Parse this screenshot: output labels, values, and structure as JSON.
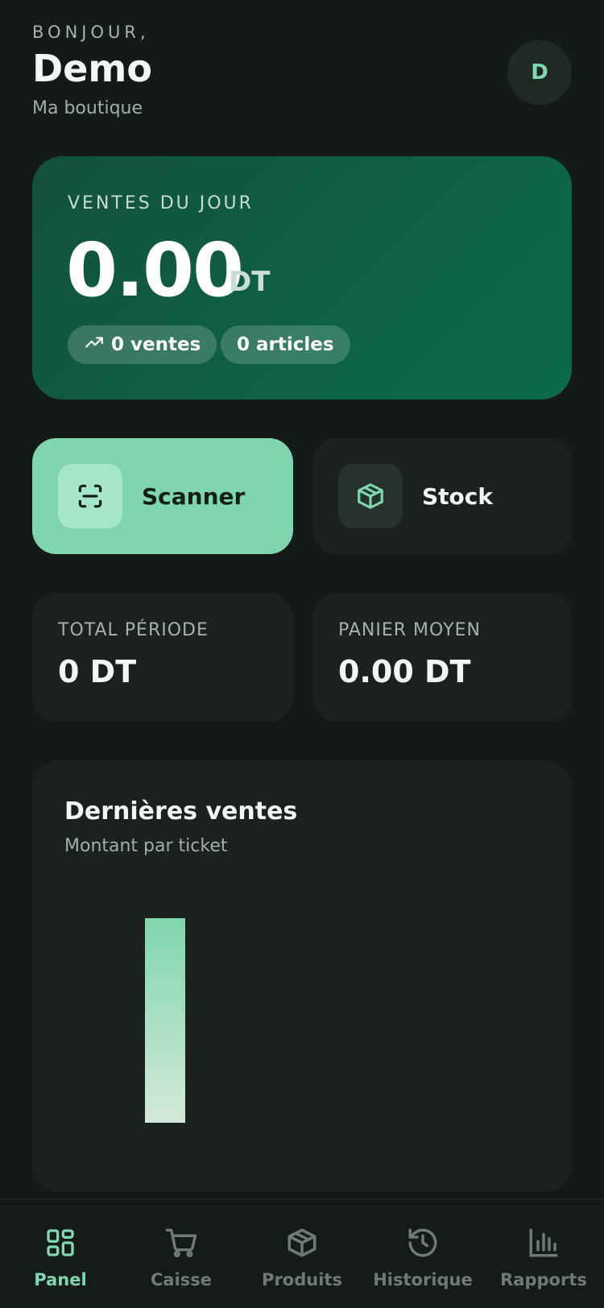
{
  "header": {
    "greeting": "BONJOUR,",
    "user_name": "Demo",
    "shop_name": "Ma boutique",
    "avatar_initial": "D"
  },
  "today_sales": {
    "label": "VENTES DU JOUR",
    "amount": "0.00",
    "currency": "DT",
    "sales_count": "0 ventes",
    "articles_count": "0 articles"
  },
  "actions": {
    "scanner_label": "Scanner",
    "stock_label": "Stock"
  },
  "stats": {
    "total_label": "TOTAL PÉRIODE",
    "total_value": "0 DT",
    "average_label": "PANIER MOYEN",
    "average_value": "0.00 DT"
  },
  "chart_card": {
    "title": "Dernières ventes",
    "subtitle": "Montant par ticket"
  },
  "chart_data": {
    "type": "bar",
    "title": "Dernières ventes",
    "subtitle": "Montant par ticket",
    "categories": [
      ""
    ],
    "values": [
      1
    ],
    "ylim": [
      0,
      1
    ],
    "grid": false,
    "legend": "none",
    "colors": {
      "bar_top": "#7fd6ae",
      "bar_bottom": "#d4e8d9"
    }
  },
  "nav": {
    "items": [
      {
        "label": "Panel",
        "icon": "grid-icon",
        "active": true
      },
      {
        "label": "Caisse",
        "icon": "cart-icon",
        "active": false
      },
      {
        "label": "Produits",
        "icon": "box-icon",
        "active": false
      },
      {
        "label": "Historique",
        "icon": "history-icon",
        "active": false
      },
      {
        "label": "Rapports",
        "icon": "chart-icon",
        "active": false
      }
    ]
  },
  "colors": {
    "background": "#131a17",
    "accent": "#7fd8b0",
    "card": "#1b211e",
    "sales_card": "#0e6246"
  }
}
